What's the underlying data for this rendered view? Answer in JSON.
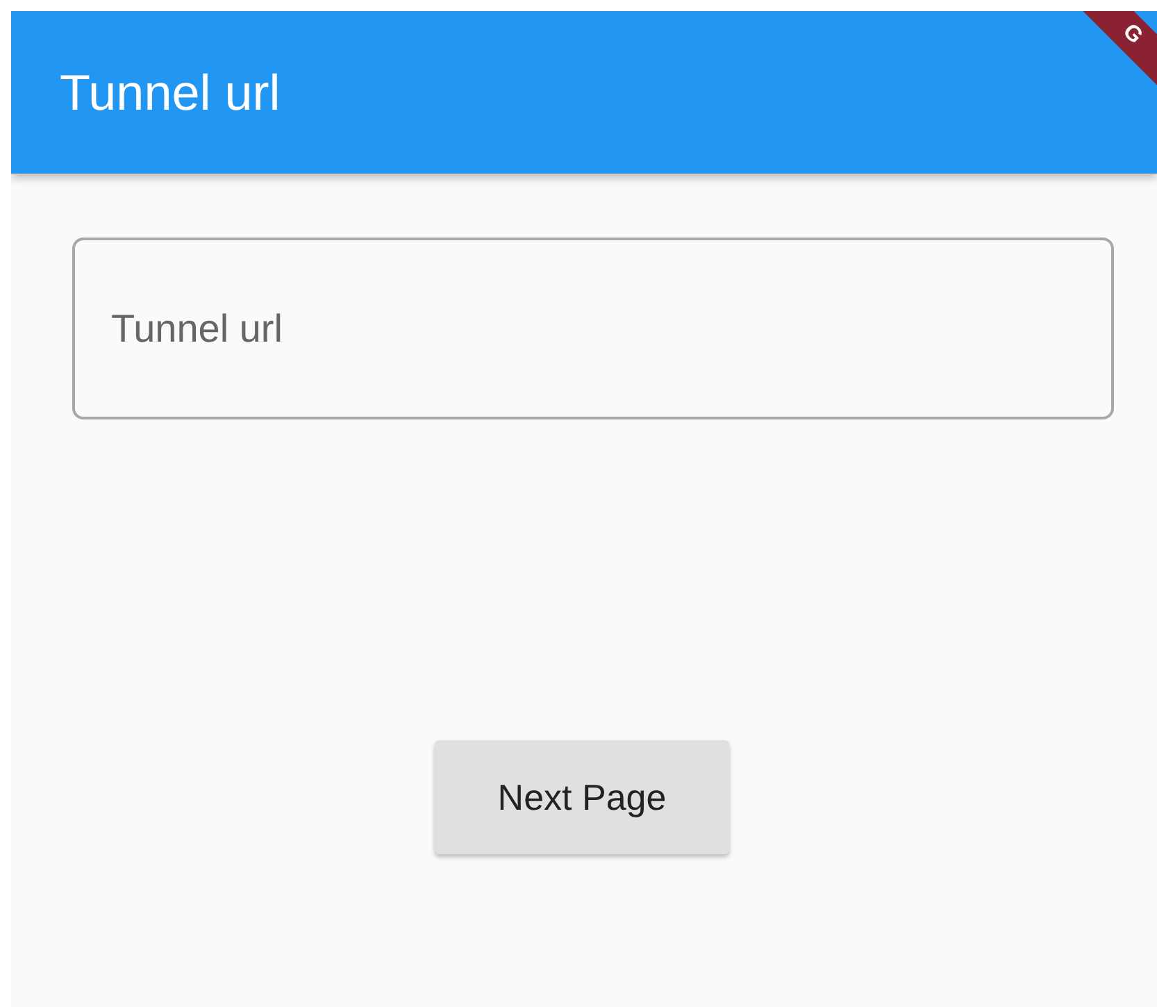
{
  "app_bar": {
    "title": "Tunnel url"
  },
  "debug_banner": {
    "text": "G"
  },
  "url_field": {
    "placeholder": "Tunnel url"
  },
  "next_button": {
    "label": "Next Page"
  }
}
